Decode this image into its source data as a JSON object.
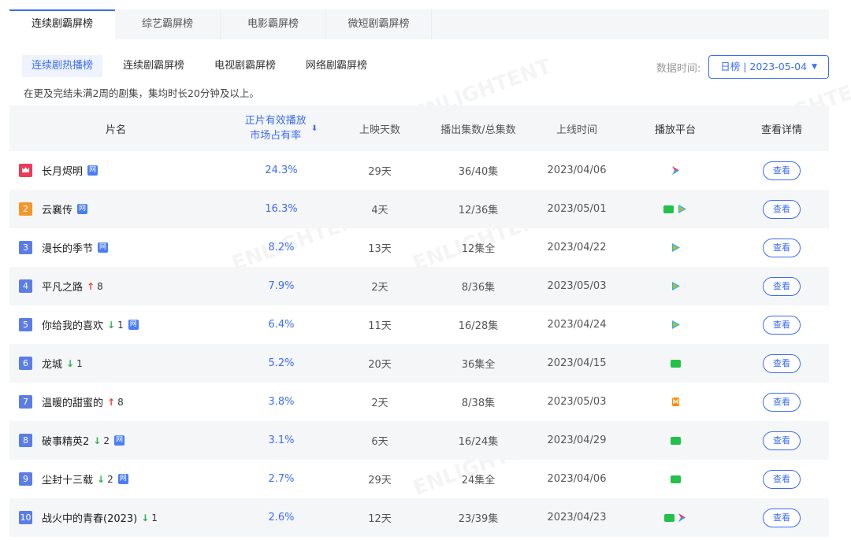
{
  "top_tabs": [
    "连续剧霸屏榜",
    "综艺霸屏榜",
    "电影霸屏榜",
    "微短剧霸屏榜"
  ],
  "sub_tabs": [
    "连续剧热播榜",
    "连续剧霸屏榜",
    "电视剧霸屏榜",
    "网络剧霸屏榜"
  ],
  "date_label": "数据时间:",
  "date_value": "日榜 | 2023-05-04",
  "note": "在更及完结未满2周的剧集，集均时长20分钟及以上。",
  "headers": {
    "name": "片名",
    "share_line1": "正片有效播放",
    "share_line2": "市场占有率",
    "days": "上映天数",
    "eps": "播出集数/总集数",
    "date": "上线时间",
    "platform": "播放平台",
    "detail": "查看详情"
  },
  "detail_btn": "查看",
  "colors": {
    "accent": "#3b6cf6",
    "rank1": "#ee3a5a",
    "rank2": "#f5962b",
    "rank_other": "#5b7de6",
    "up": "#e8403a",
    "down": "#2bb24c"
  },
  "rows": [
    {
      "rank": "",
      "rank_icon": "crown-icon",
      "title": "长月烬明",
      "trend_dir": "",
      "trend_num": "",
      "wang": "网",
      "share": "24.3%",
      "days": "29天",
      "eps": "36/40集",
      "date": "2023/04/06",
      "platforms": [
        "youku"
      ]
    },
    {
      "rank": "2",
      "title": "云襄传",
      "trend_dir": "",
      "trend_num": "",
      "wang": "网",
      "share": "16.3%",
      "days": "4天",
      "eps": "12/36集",
      "date": "2023/05/01",
      "platforms": [
        "iqiyi",
        "tencent"
      ]
    },
    {
      "rank": "3",
      "title": "漫长的季节",
      "trend_dir": "",
      "trend_num": "",
      "wang": "网",
      "share": "8.2%",
      "days": "13天",
      "eps": "12集全",
      "date": "2023/04/22",
      "platforms": [
        "tencent"
      ]
    },
    {
      "rank": "4",
      "title": "平凡之路",
      "trend_dir": "up",
      "trend_num": "8",
      "wang": "",
      "share": "7.9%",
      "days": "2天",
      "eps": "8/36集",
      "date": "2023/05/03",
      "platforms": [
        "tencent"
      ]
    },
    {
      "rank": "5",
      "title": "你给我的喜欢",
      "trend_dir": "down",
      "trend_num": "1",
      "wang": "网",
      "share": "6.4%",
      "days": "11天",
      "eps": "16/28集",
      "date": "2023/04/24",
      "platforms": [
        "tencent"
      ]
    },
    {
      "rank": "6",
      "title": "龙城",
      "trend_dir": "down",
      "trend_num": "1",
      "wang": "",
      "share": "5.2%",
      "days": "20天",
      "eps": "36集全",
      "date": "2023/04/15",
      "platforms": [
        "iqiyi"
      ]
    },
    {
      "rank": "7",
      "title": "温暖的甜蜜的",
      "trend_dir": "up",
      "trend_num": "8",
      "wang": "",
      "share": "3.8%",
      "days": "2天",
      "eps": "8/38集",
      "date": "2023/05/03",
      "platforms": [
        "mango"
      ]
    },
    {
      "rank": "8",
      "title": "破事精英2",
      "trend_dir": "down",
      "trend_num": "2",
      "wang": "网",
      "share": "3.1%",
      "days": "6天",
      "eps": "16/24集",
      "date": "2023/04/29",
      "platforms": [
        "iqiyi"
      ]
    },
    {
      "rank": "9",
      "title": "尘封十三载",
      "trend_dir": "down",
      "trend_num": "2",
      "wang": "网",
      "share": "2.7%",
      "days": "29天",
      "eps": "24集全",
      "date": "2023/04/06",
      "platforms": [
        "iqiyi"
      ]
    },
    {
      "rank": "10",
      "title": "战火中的青春(2023)",
      "trend_dir": "down",
      "trend_num": "1",
      "wang": "",
      "share": "2.6%",
      "days": "12天",
      "eps": "23/39集",
      "date": "2023/04/23",
      "platforms": [
        "iqiyi",
        "youku"
      ]
    }
  ]
}
